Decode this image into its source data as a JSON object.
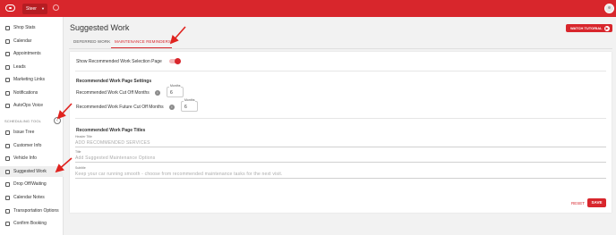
{
  "topbar": {
    "shop_name": "Steer",
    "accent_color": "#d8262c",
    "icons": [
      "logo-icon",
      "gear-icon",
      "avatar-icon"
    ]
  },
  "sidebar": {
    "items": [
      {
        "label": "Shop Stats",
        "icon": "grid-icon"
      },
      {
        "label": "Calendar",
        "icon": "calendar-icon"
      },
      {
        "label": "Appointments",
        "icon": "list-icon"
      },
      {
        "label": "Leads",
        "icon": "megaphone-icon"
      },
      {
        "label": "Marketing Links",
        "icon": "grid-icon"
      },
      {
        "label": "Notifications",
        "icon": "bell-icon"
      },
      {
        "label": "AutoOps Voice",
        "icon": "phone-icon"
      }
    ],
    "section_label": "SCHEDULING TOOL",
    "collapse_symbol": "‹",
    "scheduling_items": [
      {
        "label": "Issue Tree",
        "icon": "tree-icon"
      },
      {
        "label": "Customer Info",
        "icon": "person-icon"
      },
      {
        "label": "Vehicle Info",
        "icon": "car-icon"
      },
      {
        "label": "Suggested Work",
        "icon": "wrench-icon",
        "active": true
      },
      {
        "label": "Drop Off/Waiting",
        "icon": "clock-icon"
      },
      {
        "label": "Calendar Notes",
        "icon": "calendar-icon"
      },
      {
        "label": "Transportation Options",
        "icon": "bus-icon"
      },
      {
        "label": "Confirm Booking",
        "icon": "check-icon"
      }
    ]
  },
  "main": {
    "title": "Suggested Work",
    "watch_tutorial": "WATCH TUTORIAL",
    "tabs": [
      {
        "label": "DEFERRED WORK",
        "active": false
      },
      {
        "label": "MAINTENANCE REMINDERS",
        "active": true
      }
    ],
    "show_toggle_label": "Show Recommended Work Selection Page",
    "show_toggle_on": true,
    "settings_heading": "Recommended Work Page Settings",
    "cutoff_label": "Recommended Work Cut Off Months",
    "cutoff_caption": "Months",
    "cutoff_value": "6",
    "future_cutoff_label": "Recommended Work Future Cut Off Months",
    "future_cutoff_caption": "Months",
    "future_cutoff_value": "6",
    "titles_heading": "Recommended Work Page Titles",
    "header_title_caption": "Header Title",
    "header_title_placeholder": "ADD RECOMMENDED SERVICES",
    "title_caption": "Title",
    "title_placeholder": "Add Suggested Maintenance Options",
    "subtitle_caption": "Subtitle",
    "subtitle_placeholder": "Keep your car running smooth - choose from recommended maintenance tasks for the next visit.",
    "reset_label": "RESET",
    "save_label": "SAVE"
  }
}
